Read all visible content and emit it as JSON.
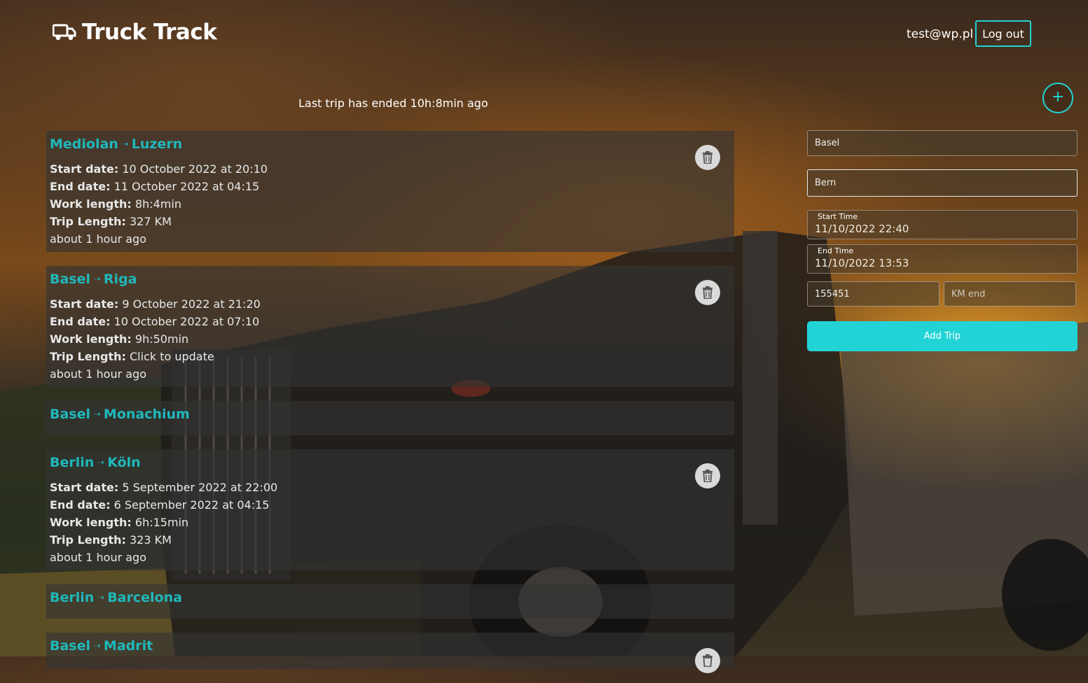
{
  "brand": {
    "title": "Truck Track",
    "icon": "truck-icon"
  },
  "user": {
    "email": "test@wp.pl",
    "logout_label": "Log out"
  },
  "status_message": "Last trip has ended 10h:8min ago",
  "add_button_symbol": "+",
  "labels": {
    "start": "Start date:",
    "end": "End date:",
    "work": "Work length:",
    "trip": "Trip Length:"
  },
  "trips": [
    {
      "from": "Mediolan",
      "to": "Luzern",
      "start": "10 October 2022 at 20:10",
      "end": "11 October 2022 at 04:15",
      "work": "8h:4min",
      "length": "327 KM",
      "ago": "about 1 hour ago"
    },
    {
      "from": "Basel",
      "to": "Riga",
      "start": "9 October 2022 at 21:20",
      "end": "10 October 2022 at 07:10",
      "work": "9h:50min",
      "length": "Click to update",
      "ago": "about 1 hour ago"
    },
    {
      "from": "Basel",
      "to": "Monachium"
    },
    {
      "from": "Berlin",
      "to": "Köln",
      "start": "5 September 2022 at 22:00",
      "end": "6 September 2022 at 04:15",
      "work": "6h:15min",
      "length": "323 KM",
      "ago": "about 1 hour ago"
    },
    {
      "from": "Berlin",
      "to": "Barcelona"
    },
    {
      "from": "Basel",
      "to": "Madrit"
    }
  ],
  "form": {
    "from_value": "Basel",
    "to_value": "Bern",
    "start_label": "Start Time",
    "start_value": "11/10/2022 22:40",
    "end_label": "End Time",
    "end_value": "11/10/2022 13:53",
    "km_start_value": "155451",
    "km_end_placeholder": "KM end",
    "submit_label": "Add Trip"
  },
  "colors": {
    "accent": "#22d3d6",
    "title": "#1fb8bb"
  }
}
